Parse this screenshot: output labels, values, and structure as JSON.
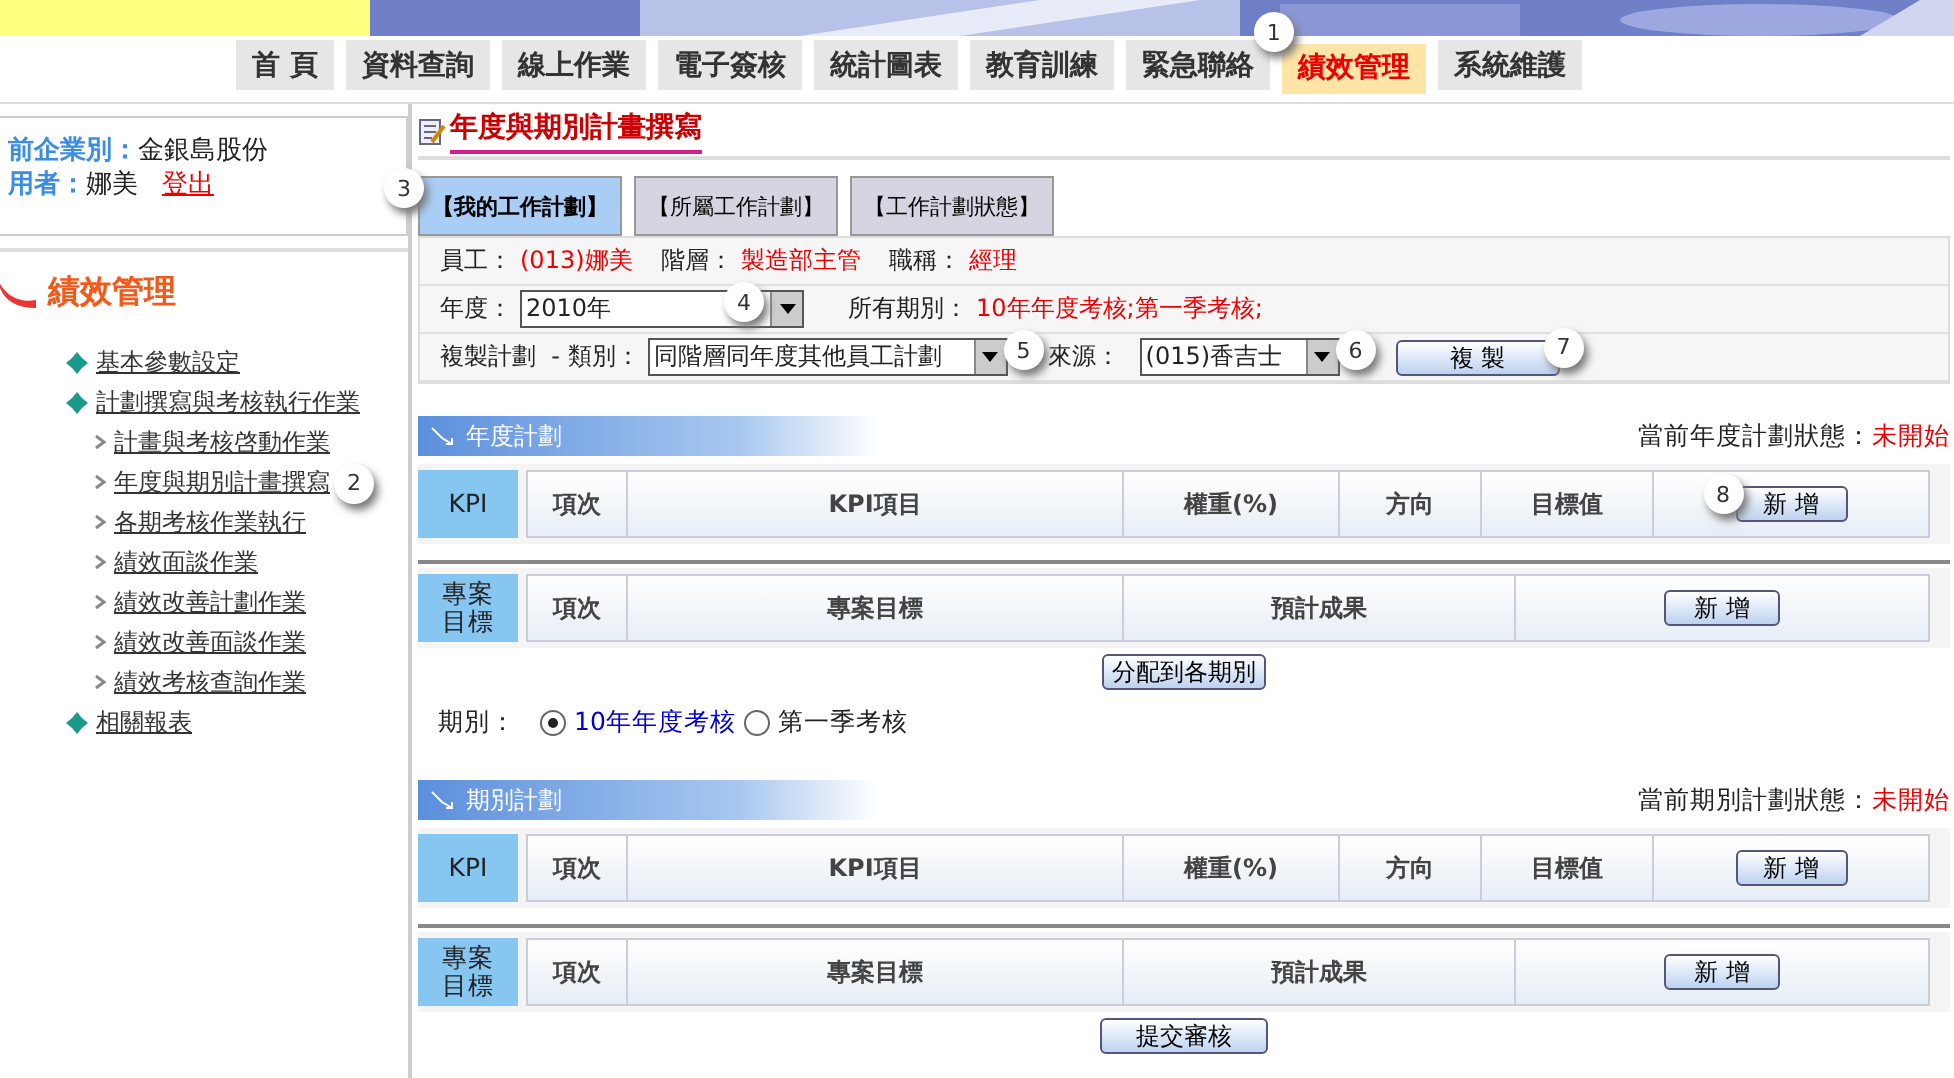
{
  "nav": [
    {
      "label": "首 頁",
      "selected": false
    },
    {
      "label": "資料查詢",
      "selected": false
    },
    {
      "label": "線上作業",
      "selected": false
    },
    {
      "label": "電子簽核",
      "selected": false
    },
    {
      "label": "統計圖表",
      "selected": false
    },
    {
      "label": "教育訓練",
      "selected": false
    },
    {
      "label": "緊急聯絡",
      "selected": false
    },
    {
      "label": "績效管理",
      "selected": true,
      "callout": "1"
    },
    {
      "label": "系統維護",
      "selected": false
    }
  ],
  "user_panel": {
    "company_label": "前企業別：",
    "company": "金銀島股份",
    "user_label": "用者：",
    "user": "娜美",
    "logout": "登出"
  },
  "sidebar": {
    "title": "績效管理",
    "items": [
      {
        "label": "基本參數設定"
      },
      {
        "label": "計劃撰寫與考核執行作業",
        "children": [
          {
            "label": "計畫與考核啓動作業"
          },
          {
            "label": "年度與期別計畫撰寫",
            "callout": "2"
          },
          {
            "label": "各期考核作業執行"
          },
          {
            "label": "績效面談作業"
          },
          {
            "label": "績效改善計劃作業"
          },
          {
            "label": "績效改善面談作業"
          },
          {
            "label": "績效考核查詢作業"
          }
        ]
      },
      {
        "label": "相關報表"
      }
    ]
  },
  "page_title": "年度與期別計畫撰寫",
  "tabs": [
    {
      "label": "【我的工作計劃】",
      "selected": true,
      "callout": "3"
    },
    {
      "label": "【所屬工作計劃】",
      "selected": false
    },
    {
      "label": "【工作計劃狀態】",
      "selected": false
    }
  ],
  "info": {
    "employee_label": "員工：",
    "employee": "(013)娜美",
    "rank_label": "階層：",
    "rank": "製造部主管",
    "title_label": "職稱：",
    "title": "經理"
  },
  "year": {
    "label": "年度：",
    "value": "2010年",
    "callout": "4",
    "periods_label": "所有期別：",
    "periods": "10年年度考核;第一季考核;"
  },
  "copy": {
    "label": "複製計劃  - 類別：",
    "category": "同階層同年度其他員工計劃",
    "category_callout": "5",
    "source_label": "來源：",
    "source": "(015)香吉士",
    "source_callout": "6",
    "button": "複 製",
    "button_callout": "7"
  },
  "annual_plan": {
    "title": "年度計劃",
    "status_label": "當前年度計劃狀態：",
    "status": "未開始",
    "kpi": {
      "label": "KPI",
      "columns": [
        "項次",
        "KPI項目",
        "權重(%)",
        "方向",
        "目標值"
      ],
      "button": "新 增",
      "callout": "8"
    },
    "project": {
      "label": "專案目標",
      "columns": [
        "項次",
        "專案目標",
        "預計成果"
      ],
      "button": "新 增"
    }
  },
  "distribute_button": "分配到各期別",
  "period_choice": {
    "label": "期別：",
    "options": [
      {
        "label": "10年年度考核",
        "selected": true
      },
      {
        "label": "第一季考核",
        "selected": false
      }
    ]
  },
  "period_plan": {
    "title": "期別計劃",
    "status_label": "當前期別計劃狀態：",
    "status": "未開始",
    "kpi": {
      "label": "KPI",
      "columns": [
        "項次",
        "KPI項目",
        "權重(%)",
        "方向",
        "目標值"
      ],
      "button": "新 增"
    },
    "project": {
      "label": "專案目標",
      "columns": [
        "項次",
        "專案目標",
        "預計成果"
      ],
      "button": "新 增"
    }
  },
  "submit_button": "提交審核"
}
